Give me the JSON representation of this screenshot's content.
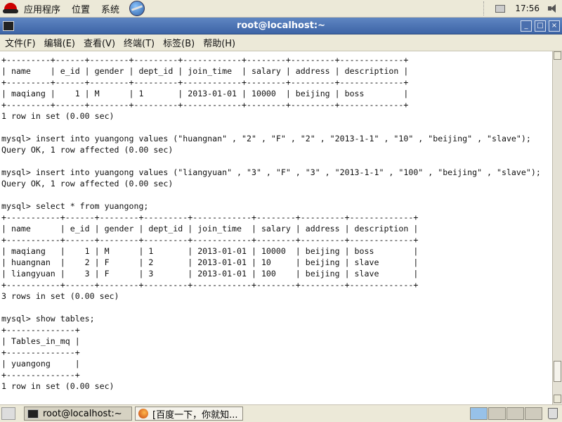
{
  "top_panel": {
    "menus": [
      "应用程序",
      "位置",
      "系统"
    ],
    "clock": "17:56"
  },
  "window": {
    "title": "root@localhost:~"
  },
  "menubar": {
    "items": [
      "文件(F)",
      "编辑(E)",
      "查看(V)",
      "终端(T)",
      "标签(B)",
      "帮助(H)"
    ]
  },
  "terminal": {
    "lines": [
      "+---------+------+--------+---------+------------+--------+---------+-------------+",
      "| name    | e_id | gender | dept_id | join_time  | salary | address | description |",
      "+---------+------+--------+---------+------------+--------+---------+-------------+",
      "| maqiang |    1 | M      | 1       | 2013-01-01 | 10000  | beijing | boss        |",
      "+---------+------+--------+---------+------------+--------+---------+-------------+",
      "1 row in set (0.00 sec)",
      "",
      "mysql> insert into yuangong values (\"huangnan\" , \"2\" , \"F\" , \"2\" , \"2013-1-1\" , \"10\" , \"beijing\" , \"slave\");",
      "Query OK, 1 row affected (0.00 sec)",
      "",
      "mysql> insert into yuangong values (\"liangyuan\" , \"3\" , \"F\" , \"3\" , \"2013-1-1\" , \"100\" , \"beijing\" , \"slave\");",
      "Query OK, 1 row affected (0.00 sec)",
      "",
      "mysql> select * from yuangong;",
      "+-----------+------+--------+---------+------------+--------+---------+-------------+",
      "| name      | e_id | gender | dept_id | join_time  | salary | address | description |",
      "+-----------+------+--------+---------+------------+--------+---------+-------------+",
      "| maqiang   |    1 | M      | 1       | 2013-01-01 | 10000  | beijing | boss        |",
      "| huangnan  |    2 | F      | 2       | 2013-01-01 | 10     | beijing | slave       |",
      "| liangyuan |    3 | F      | 3       | 2013-01-01 | 100    | beijing | slave       |",
      "+-----------+------+--------+---------+------------+--------+---------+-------------+",
      "3 rows in set (0.00 sec)",
      "",
      "mysql> show tables;",
      "+--------------+",
      "| Tables_in_mq |",
      "+--------------+",
      "| yuangong     |",
      "+--------------+",
      "1 row in set (0.00 sec)"
    ]
  },
  "taskbar": {
    "tasks": [
      "root@localhost:~",
      "[百度一下，你就知..."
    ]
  }
}
